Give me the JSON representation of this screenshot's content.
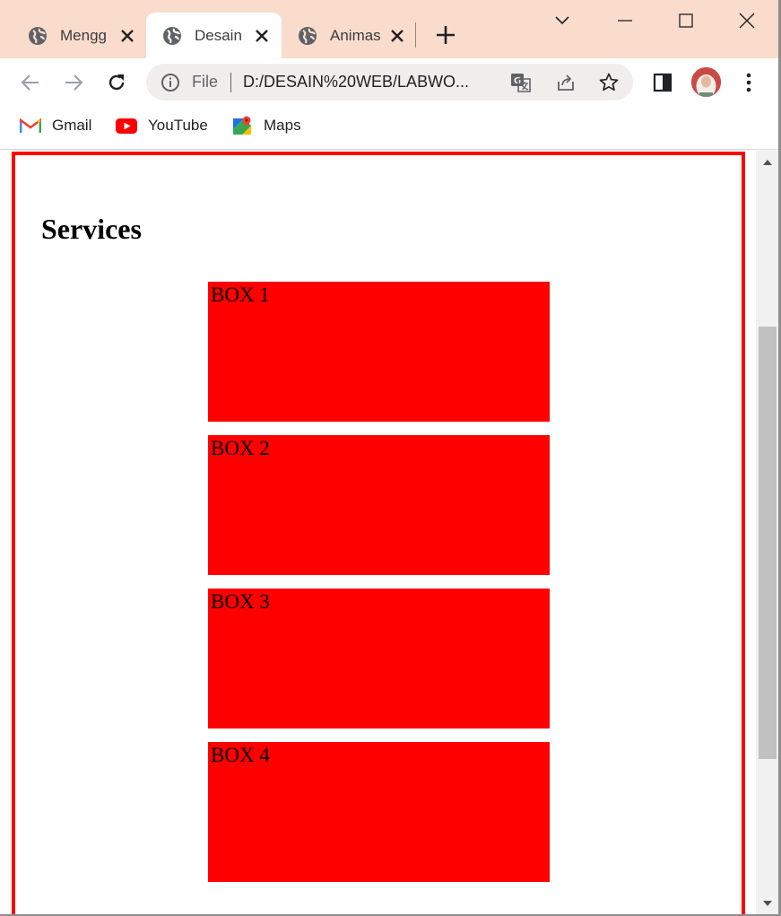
{
  "tabs": [
    {
      "title": "Mengg",
      "close_icon": "close-icon"
    },
    {
      "title": "Desain",
      "close_icon": "close-icon"
    },
    {
      "title": "Animas",
      "close_icon": "close-icon"
    }
  ],
  "toolbar": {
    "scheme_label": "File",
    "url": "D:/DESAIN%20WEB/LABWO..."
  },
  "bookmarks": [
    {
      "label": "Gmail",
      "icon": "gmail-icon"
    },
    {
      "label": "YouTube",
      "icon": "youtube-icon"
    },
    {
      "label": "Maps",
      "icon": "maps-icon"
    }
  ],
  "page": {
    "heading": "Services",
    "boxes": [
      {
        "label": "BOX 1"
      },
      {
        "label": "BOX 2"
      },
      {
        "label": "BOX 3"
      },
      {
        "label": "BOX 4"
      }
    ]
  },
  "colors": {
    "tabstrip": "#f9dccc",
    "box_fill": "#ff0000",
    "section_border": "#ff0000"
  }
}
